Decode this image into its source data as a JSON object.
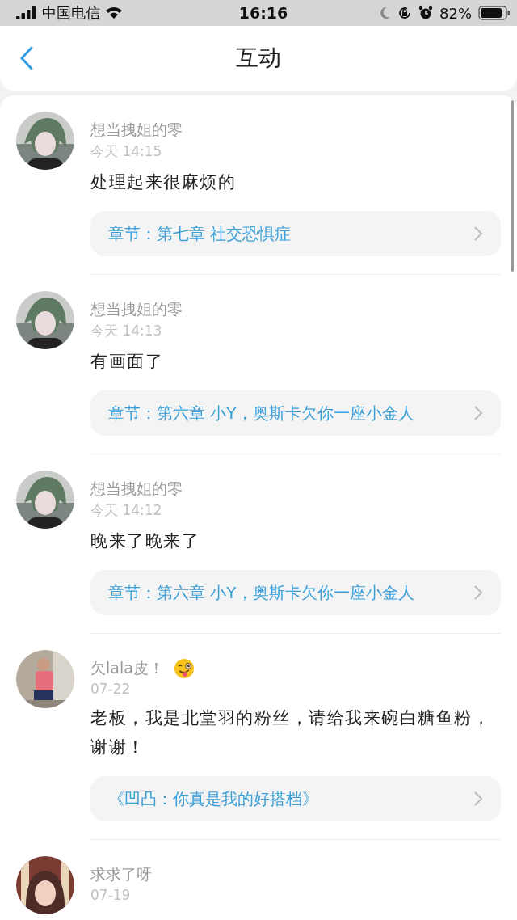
{
  "status_bar": {
    "carrier": "中国电信",
    "time": "16:16",
    "battery": "82%"
  },
  "header": {
    "title": "互动"
  },
  "comments": [
    {
      "user": "想当拽姐的零",
      "time": "今天 14:15",
      "text": "处理起来很麻烦的",
      "link": "章节：第七章 社交恐惧症",
      "emoji": false
    },
    {
      "user": "想当拽姐的零",
      "time": "今天 14:13",
      "text": "有画面了",
      "link": "章节：第六章 小Y，奥斯卡欠你一座小金人",
      "emoji": false
    },
    {
      "user": "想当拽姐的零",
      "time": "今天 14:12",
      "text": "晚来了晚来了",
      "link": "章节：第六章 小Y，奥斯卡欠你一座小金人",
      "emoji": false
    },
    {
      "user": "欠lala皮！",
      "time": "07-22",
      "text": "老板，我是北堂羽的粉丝，请给我来碗白糖鱼粉，谢谢！",
      "link": "《凹凸：你真是我的好搭档》",
      "emoji": true
    },
    {
      "user": "求求了呀",
      "time": "07-19",
      "emoji": false
    }
  ]
}
